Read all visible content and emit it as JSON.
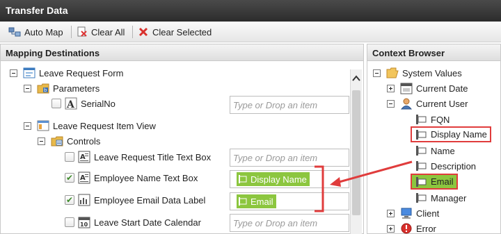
{
  "window": {
    "title": "Transfer Data"
  },
  "toolbar": {
    "auto_map": "Auto Map",
    "clear_all": "Clear All",
    "clear_selected": "Clear Selected"
  },
  "left_panel": {
    "title": "Mapping Destinations",
    "root": "Leave Request Form",
    "parameters": "Parameters",
    "serialno": "SerialNo",
    "item_view": "Leave Request Item View",
    "controls": "Controls",
    "rows": [
      {
        "label": "Leave Request Title Text Box",
        "checked": false
      },
      {
        "label": "Employee Name Text Box",
        "checked": true,
        "value": "Display Name"
      },
      {
        "label": "Employee Email Data Label",
        "checked": true,
        "value": "Email"
      },
      {
        "label": "Leave Start Date Calendar",
        "checked": false
      }
    ],
    "placeholder": "Type or Drop an item"
  },
  "right_panel": {
    "title": "Context Browser",
    "system_values": "System Values",
    "current_date": "Current Date",
    "current_user": "Current User",
    "user_fields": [
      "FQN",
      "Display Name",
      "Name",
      "Description",
      "Email",
      "Manager"
    ],
    "client": "Client",
    "error": "Error"
  },
  "colors": {
    "highlight": "#e03c3c",
    "value_pill": "#8cc63f",
    "titlebar": "#3a3a3a"
  }
}
